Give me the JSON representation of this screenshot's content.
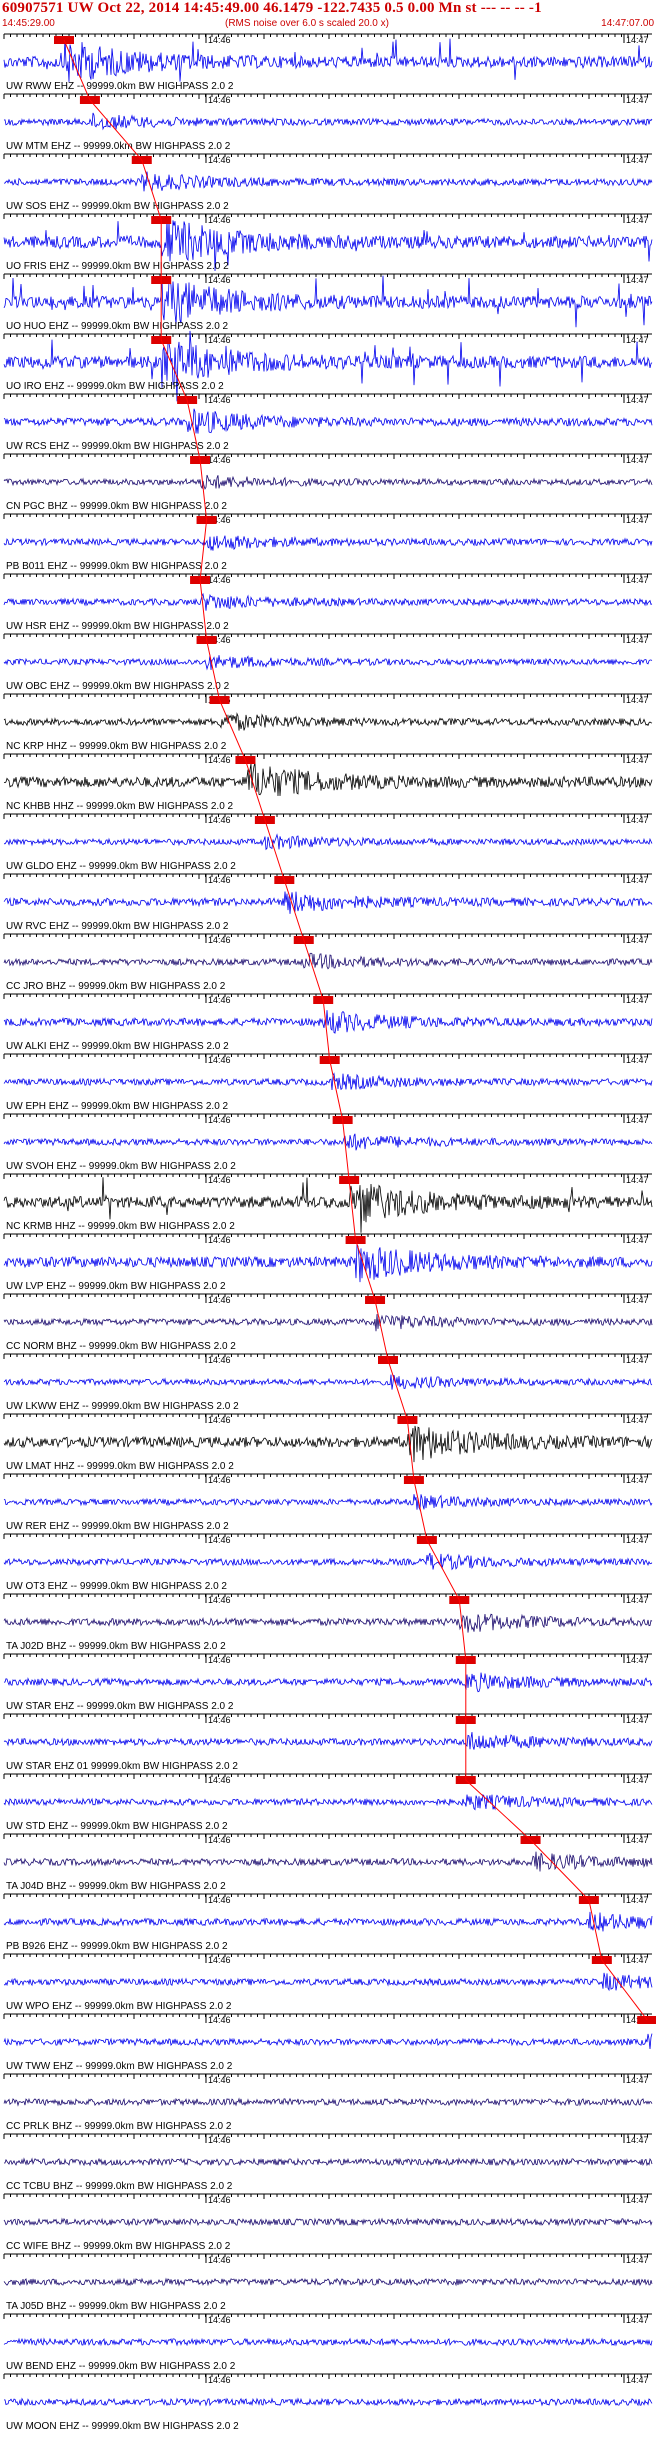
{
  "header": {
    "title": "60907571 UW Oct 22, 2014 14:45:49.00   46.1479 -122.7435  0.5 0.00 Mn st --- -- -- -1",
    "start_time": "14:45:29.00",
    "rms_note": "(RMS noise over 6.0 s scaled 20.0 x)",
    "end_time": "14:47:07.00"
  },
  "tick_times": {
    "t1": "14:46",
    "t2": "14:47"
  },
  "colors": {
    "blue": "#0000ee",
    "black": "#000000",
    "purple": "#1a0a6e",
    "red": "#ff0000",
    "pick": "#dd0000"
  },
  "traces": [
    {
      "label": "UW RWW EHZ -- 99999.0km BW  HIGHPASS  2.0  2",
      "color": "blue",
      "amp": 0.9,
      "pick": 0.0
    },
    {
      "label": "UW MTM EHZ -- 99999.0km BW  HIGHPASS  2.0  2",
      "color": "blue",
      "amp": 0.3,
      "pick": 0.04
    },
    {
      "label": "UW SOS EHZ -- 99999.0km BW  HIGHPASS  2.0  2",
      "color": "blue",
      "amp": 0.35,
      "pick": 0.12
    },
    {
      "label": "UO FRIS EHZ -- 99999.0km BW  HIGHPASS  2.0  2",
      "color": "blue",
      "amp": 1.0,
      "pick": 0.15
    },
    {
      "label": "UO HUO EHZ -- 99999.0km BW  HIGHPASS  2.0  2",
      "color": "blue",
      "amp": 1.0,
      "pick": 0.15
    },
    {
      "label": "UO IRO EHZ -- 99999.0km BW  HIGHPASS  2.0  2",
      "color": "blue",
      "amp": 1.0,
      "pick": 0.15
    },
    {
      "label": "UW RCS EHZ -- 99999.0km BW  HIGHPASS  2.0  2",
      "color": "blue",
      "amp": 0.5,
      "pick": 0.19
    },
    {
      "label": "CN PGC BHZ -- 99999.0km BW  HIGHPASS  2.0  2",
      "color": "purple",
      "amp": 0.25,
      "pick": 0.21
    },
    {
      "label": "PB B011 EHZ -- 99999.0km BW  HIGHPASS  2.0  2",
      "color": "blue",
      "amp": 0.3,
      "pick": 0.22
    },
    {
      "label": "UW HSR EHZ -- 99999.0km BW  HIGHPASS  2.0  2",
      "color": "blue",
      "amp": 0.3,
      "pick": 0.21
    },
    {
      "label": "UW OBC EHZ -- 99999.0km BW  HIGHPASS  2.0  2",
      "color": "blue",
      "amp": 0.25,
      "pick": 0.22
    },
    {
      "label": "NC KRP HHZ -- 99999.0km BW  HIGHPASS  2.0  2",
      "color": "black",
      "amp": 0.35,
      "pick": 0.24
    },
    {
      "label": "NC KHBB HHZ -- 99999.0km BW  HIGHPASS  2.0  2",
      "color": "black",
      "amp": 0.8,
      "pick": 0.28
    },
    {
      "label": "UW GLDO EHZ -- 99999.0km BW  HIGHPASS  2.0  2",
      "color": "blue",
      "amp": 0.25,
      "pick": 0.31
    },
    {
      "label": "UW RVC EHZ -- 99999.0km BW  HIGHPASS  2.0  2",
      "color": "blue",
      "amp": 0.45,
      "pick": 0.34
    },
    {
      "label": "CC JRO BHZ -- 99999.0km BW  HIGHPASS  2.0  2",
      "color": "purple",
      "amp": 0.3,
      "pick": 0.37
    },
    {
      "label": "UW ALKI EHZ -- 99999.0km BW  HIGHPASS  2.0  2",
      "color": "blue",
      "amp": 0.45,
      "pick": 0.4
    },
    {
      "label": "UW EPH EHZ -- 99999.0km BW  HIGHPASS  2.0  2",
      "color": "blue",
      "amp": 0.3,
      "pick": 0.41
    },
    {
      "label": "UW SVOH EHZ -- 99999.0km BW  HIGHPASS  2.0  2",
      "color": "blue",
      "amp": 0.3,
      "pick": 0.43
    },
    {
      "label": "NC KRMB HHZ -- 99999.0km BW  HIGHPASS  2.0  2",
      "color": "black",
      "amp": 0.9,
      "pick": 0.44
    },
    {
      "label": "UW LVP EHZ -- 99999.0km BW  HIGHPASS  2.0  2",
      "color": "blue",
      "amp": 0.8,
      "pick": 0.45
    },
    {
      "label": "CC NORM BHZ -- 99999.0km BW  HIGHPASS  2.0  2",
      "color": "purple",
      "amp": 0.3,
      "pick": 0.48
    },
    {
      "label": "UW LKWW EHZ -- 99999.0km BW  HIGHPASS  2.0  2",
      "color": "blue",
      "amp": 0.25,
      "pick": 0.5
    },
    {
      "label": "UW LMAT HHZ -- 99999.0km BW  HIGHPASS  2.0  2",
      "color": "black",
      "amp": 0.8,
      "pick": 0.53
    },
    {
      "label": "UW RER EHZ -- 99999.0km BW  HIGHPASS  2.0  2",
      "color": "blue",
      "amp": 0.25,
      "pick": 0.54
    },
    {
      "label": "UW OT3 EHZ -- 99999.0km BW  HIGHPASS  2.0  2",
      "color": "blue",
      "amp": 0.3,
      "pick": 0.56
    },
    {
      "label": "TA J02D BHZ -- 99999.0km BW  HIGHPASS  2.0  2",
      "color": "purple",
      "amp": 0.4,
      "pick": 0.61
    },
    {
      "label": "UW STAR EHZ -- 99999.0km BW  HIGHPASS  2.0  2",
      "color": "blue",
      "amp": 0.35,
      "pick": 0.62
    },
    {
      "label": "UW STAR EHZ 01 99999.0km BW  HIGHPASS  2.0  2",
      "color": "blue",
      "amp": 0.35,
      "pick": 0.62
    },
    {
      "label": "UW STD EHZ -- 99999.0km BW  HIGHPASS  2.0  2",
      "color": "blue",
      "amp": 0.3,
      "pick": 0.62
    },
    {
      "label": "TA J04D BHZ -- 99999.0km BW  HIGHPASS  2.0  2",
      "color": "purple",
      "amp": 0.35,
      "pick": 0.72
    },
    {
      "label": "PB B926 EHZ -- 99999.0km BW  HIGHPASS  2.0  2",
      "color": "blue",
      "amp": 0.35,
      "pick": 0.81
    },
    {
      "label": "UW WPO EHZ -- 99999.0km BW  HIGHPASS  2.0  2",
      "color": "blue",
      "amp": 0.3,
      "pick": 0.83
    },
    {
      "label": "UW TWW EHZ -- 99999.0km BW  HIGHPASS  2.0  2",
      "color": "blue",
      "amp": 0.3,
      "pick": 0.9
    },
    {
      "label": "CC PRLK BHZ -- 99999.0km BW  HIGHPASS  2.0  2",
      "color": "purple",
      "amp": 0.3,
      "pick": null
    },
    {
      "label": "CC TCBU BHZ -- 99999.0km BW  HIGHPASS  2.0  2",
      "color": "purple",
      "amp": 0.3,
      "pick": null
    },
    {
      "label": "CC WIFE BHZ -- 99999.0km BW  HIGHPASS  2.0  2",
      "color": "purple",
      "amp": 0.3,
      "pick": null
    },
    {
      "label": "TA J05D BHZ -- 99999.0km BW  HIGHPASS  2.0  2",
      "color": "purple",
      "amp": 0.3,
      "pick": null
    },
    {
      "label": "UW BEND EHZ -- 99999.0km BW  HIGHPASS  2.0  2",
      "color": "blue",
      "amp": 0.3,
      "pick": null
    },
    {
      "label": "UW MOON EHZ -- 99999.0km BW  HIGHPASS  2.0  2",
      "color": "blue",
      "amp": 0.3,
      "pick": null
    }
  ]
}
